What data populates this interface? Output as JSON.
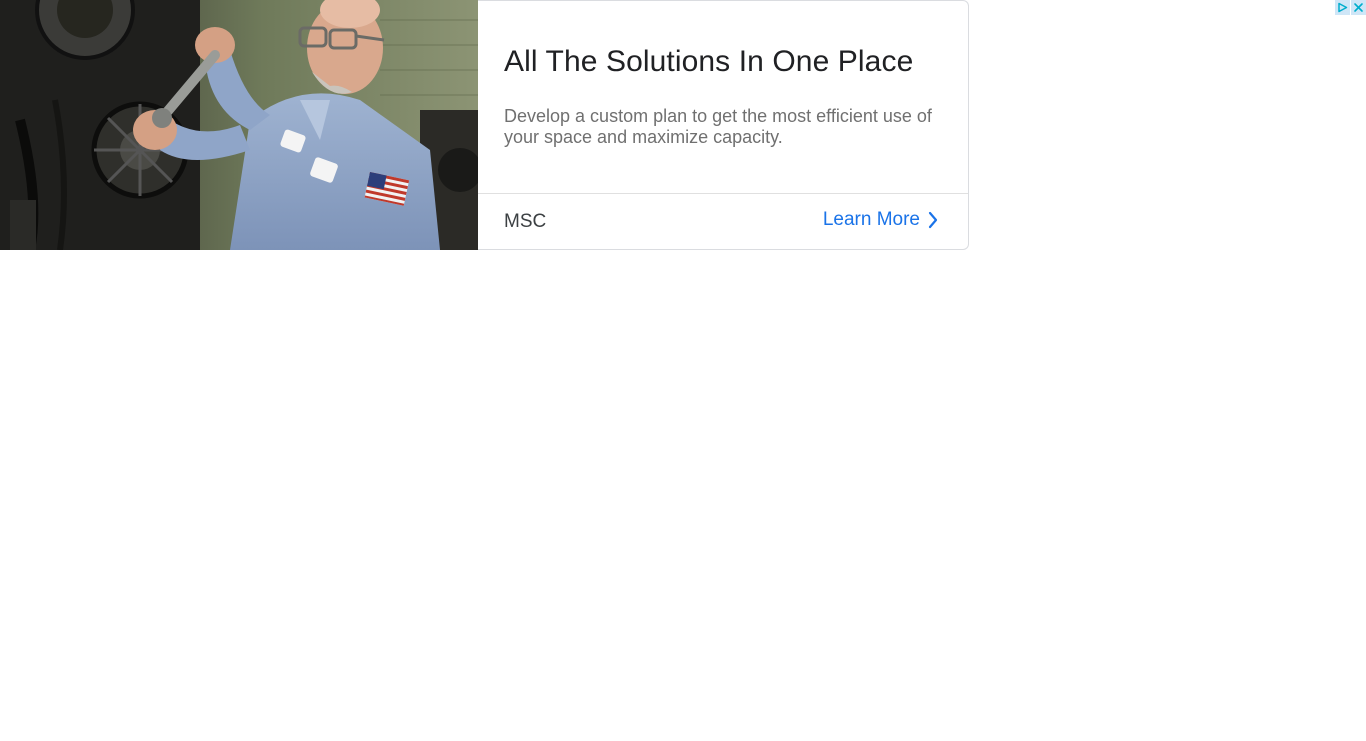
{
  "ad": {
    "headline": "All The Solutions In One Place",
    "description": "Develop a custom plan to get the most efficient use of your space and maximize capacity.",
    "advertiser": "MSC",
    "cta_label": "Learn More",
    "image_description": "photo-worker-with-wrench"
  },
  "adchoices": {
    "info_icon": "adchoices-play-icon",
    "close_icon": "close-icon"
  },
  "colors": {
    "cta": "#1a73e8",
    "headline": "#202124",
    "description": "#707070",
    "border": "#dadce0",
    "adchoices_bg": "#cfe6f7"
  }
}
